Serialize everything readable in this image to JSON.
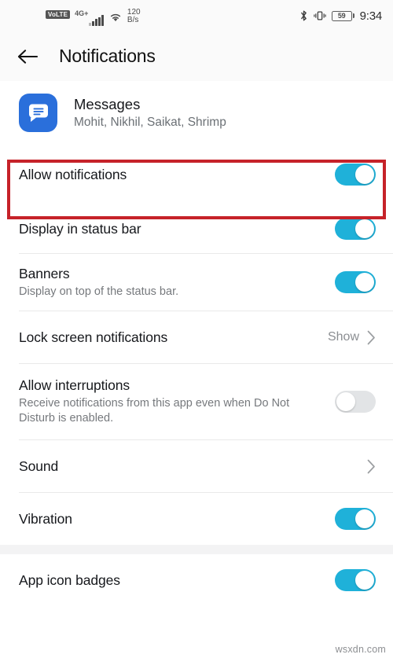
{
  "status_bar": {
    "volte_label": "VoLTE",
    "network_type": "4G+",
    "wifi_icon": "wifi-icon",
    "net_speed_value": "120",
    "net_speed_unit": "B/s",
    "bluetooth_icon": "bluetooth-icon",
    "vibrate_icon": "vibrate-icon",
    "battery_level": "59",
    "clock": "9:34"
  },
  "appbar": {
    "back_icon": "back-arrow-icon",
    "title": "Notifications"
  },
  "app_header": {
    "icon": "messages-app-icon",
    "name": "Messages",
    "subtitle": "Mohit, Nikhil, Saikat, Shrimp"
  },
  "settings": {
    "rows": [
      {
        "key": "allow_notifications",
        "title": "Allow notifications",
        "subtitle": "",
        "control": "toggle",
        "state": "on",
        "highlighted": true
      },
      {
        "key": "display_in_status_bar",
        "title": "Display in status bar",
        "subtitle": "",
        "control": "toggle",
        "state": "on"
      },
      {
        "key": "banners",
        "title": "Banners",
        "subtitle": "Display on top of the status bar.",
        "control": "toggle",
        "state": "on"
      },
      {
        "key": "lock_screen_notifications",
        "title": "Lock screen notifications",
        "subtitle": "",
        "control": "value-chevron",
        "value": "Show"
      },
      {
        "key": "allow_interruptions",
        "title": "Allow interruptions",
        "subtitle": "Receive notifications from this app even when Do Not Disturb is enabled.",
        "control": "toggle",
        "state": "off"
      },
      {
        "key": "sound",
        "title": "Sound",
        "subtitle": "",
        "control": "chevron"
      },
      {
        "key": "vibration",
        "title": "Vibration",
        "subtitle": "",
        "control": "toggle",
        "state": "on"
      },
      {
        "key": "app_icon_badges",
        "title": "App icon badges",
        "subtitle": "",
        "control": "toggle",
        "state": "on"
      }
    ]
  },
  "colors": {
    "toggle_on": "#1fb1d9",
    "toggle_off": "#e2e4e6",
    "highlight_border": "#c62229",
    "app_icon_blue": "#2a6fdb",
    "status_bar_bg": "#fafafa"
  },
  "watermark": "wsxdn.com"
}
